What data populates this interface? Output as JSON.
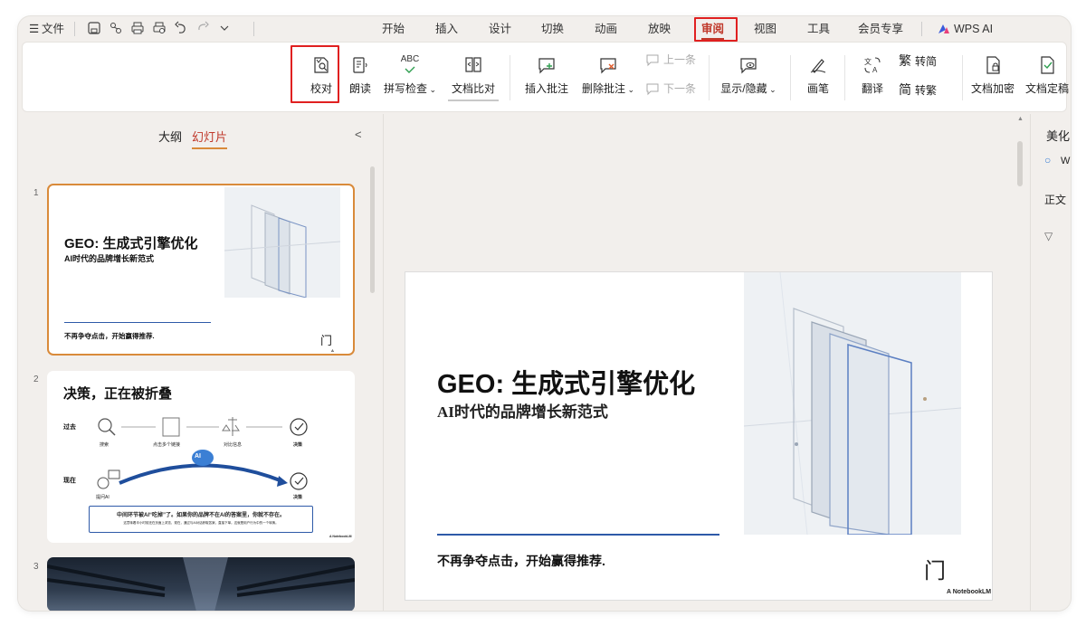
{
  "menubar": {
    "file_label": "文件",
    "tabs": [
      "开始",
      "插入",
      "设计",
      "切换",
      "动画",
      "放映",
      "审阅",
      "视图",
      "工具",
      "会员专享"
    ],
    "active_tab": "审阅",
    "wps_ai": "WPS AI"
  },
  "ribbon": {
    "proofread": "校对",
    "read_aloud": "朗读",
    "spell_check": "拼写检查",
    "doc_compare": "文档比对",
    "insert_comment": "插入批注",
    "delete_comment": "删除批注",
    "prev_comment": "上一条",
    "next_comment": "下一条",
    "show_hide": "显示/隐藏",
    "pen": "画笔",
    "translate": "翻译",
    "to_simplified": "转简",
    "to_traditional": "转繁",
    "encrypt": "文档加密",
    "finalize": "文档定稿",
    "abc": "ABC",
    "fan": "繁",
    "jian": "简"
  },
  "left_panel": {
    "outline_tab": "大纲",
    "slides_tab": "幻灯片",
    "collapse": "<"
  },
  "slides": [
    {
      "number": "1",
      "title": "GEO: 生成式引擎优化",
      "subtitle": "AI时代的品牌增长新范式",
      "footer": "不再争夺点击，开始赢得推荐.",
      "logo": "门",
      "brand": "A NotebookLM"
    },
    {
      "number": "2",
      "title": "决策，正在被折叠",
      "past_label": "过去",
      "now_label": "现在",
      "steps": [
        "搜索",
        "点击多个链接",
        "对比信息",
        "决策"
      ],
      "now_steps": [
        "提问AI",
        "决策"
      ],
      "ai_badge": "AI",
      "note_main": "中间环节被AI“吃掉”了。如果你的品牌不在AI的答案里，你就不存在。",
      "note_sub": "这意味着半小时前还在页面上浏览，现在，通过与AI对话获取答案，直接下单。这就是用户行为中的一个转换。",
      "brand": "A NotebookLM"
    },
    {
      "number": "3"
    }
  ],
  "right_panel": {
    "beautify": "美化",
    "w": "W",
    "body": "正文"
  },
  "colors": {
    "accent_red": "#c0392b",
    "highlight_box": "#e02020",
    "selection_orange": "#d98a3a",
    "slide_line_blue": "#2e5aa8"
  }
}
